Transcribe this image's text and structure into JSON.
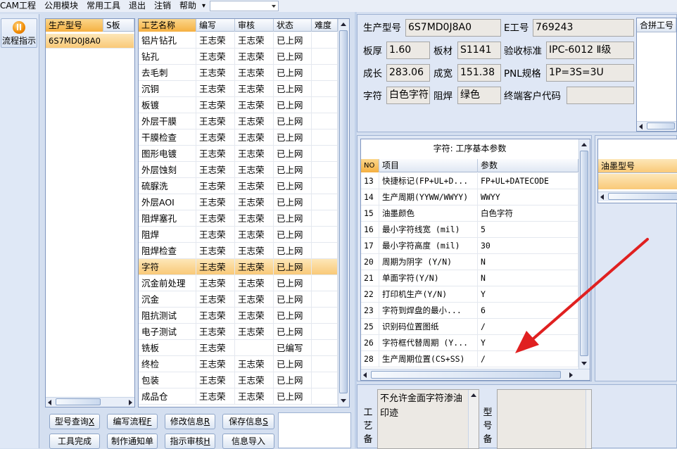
{
  "menu": {
    "items": [
      "CAM工程",
      "公用模块",
      "常用工具",
      "退出",
      "注销",
      "帮助"
    ],
    "help_dropdown": "▾",
    "combo_value": ""
  },
  "left_strip": {
    "flow_button_label": "流程指示",
    "flow_icon": "pause-circle-icon"
  },
  "model_list": {
    "columns": [
      "生产型号",
      "S板"
    ],
    "rows": [
      [
        "6S7MD0J8A0",
        ""
      ]
    ],
    "selected_index": 0
  },
  "process_grid": {
    "columns": [
      "工艺名称",
      "编写",
      "审核",
      "状态",
      "难度"
    ],
    "rows": [
      [
        "铝片钻孔",
        "王志荣",
        "王志荣",
        "已上网",
        ""
      ],
      [
        "钻孔",
        "王志荣",
        "王志荣",
        "已上网",
        ""
      ],
      [
        "去毛刺",
        "王志荣",
        "王志荣",
        "已上网",
        ""
      ],
      [
        "沉铜",
        "王志荣",
        "王志荣",
        "已上网",
        ""
      ],
      [
        "板镀",
        "王志荣",
        "王志荣",
        "已上网",
        ""
      ],
      [
        "外层干膜",
        "王志荣",
        "王志荣",
        "已上网",
        ""
      ],
      [
        "干膜检查",
        "王志荣",
        "王志荣",
        "已上网",
        ""
      ],
      [
        "图形电镀",
        "王志荣",
        "王志荣",
        "已上网",
        ""
      ],
      [
        "外层蚀刻",
        "王志荣",
        "王志荣",
        "已上网",
        ""
      ],
      [
        "硫脲洗",
        "王志荣",
        "王志荣",
        "已上网",
        ""
      ],
      [
        "外层AOI",
        "王志荣",
        "王志荣",
        "已上网",
        ""
      ],
      [
        "阻焊塞孔",
        "王志荣",
        "王志荣",
        "已上网",
        ""
      ],
      [
        "阻焊",
        "王志荣",
        "王志荣",
        "已上网",
        ""
      ],
      [
        "阻焊检查",
        "王志荣",
        "王志荣",
        "已上网",
        ""
      ],
      [
        "字符",
        "王志荣",
        "王志荣",
        "已上网",
        ""
      ],
      [
        "沉金前处理",
        "王志荣",
        "王志荣",
        "已上网",
        ""
      ],
      [
        "沉金",
        "王志荣",
        "王志荣",
        "已上网",
        ""
      ],
      [
        "阻抗测试",
        "王志荣",
        "王志荣",
        "已上网",
        ""
      ],
      [
        "电子测试",
        "王志荣",
        "王志荣",
        "已上网",
        ""
      ],
      [
        "铣板",
        "王志荣",
        "",
        "已编写",
        ""
      ],
      [
        "终检",
        "王志荣",
        "王志荣",
        "已上网",
        ""
      ],
      [
        "包装",
        "王志荣",
        "王志荣",
        "已上网",
        ""
      ],
      [
        "成品仓",
        "王志荣",
        "王志荣",
        "已上网",
        ""
      ]
    ],
    "selected_index": 14
  },
  "buttons": {
    "row1": [
      {
        "label": "型号查询",
        "key": "X"
      },
      {
        "label": "编写流程",
        "key": "F"
      },
      {
        "label": "修改信息",
        "key": "R"
      },
      {
        "label": "保存信息",
        "key": "S"
      }
    ],
    "row2": [
      {
        "label": "工具完成",
        "key": ""
      },
      {
        "label": "制作通知单",
        "key": ""
      },
      {
        "label": "指示审核",
        "key": "H"
      },
      {
        "label": "信息导入",
        "key": ""
      }
    ]
  },
  "info": {
    "model_label": "生产型号",
    "model_value": "6S7MD0J8A0",
    "e_label": "E工号",
    "e_value": "769243",
    "thickness_label": "板厚",
    "thickness_value": "1.60",
    "material_label": "板材",
    "material_value": "S1141",
    "standard_label": "验收标准",
    "standard_value": "IPC-6012 Ⅱ级",
    "length_label": "成长",
    "length_value": "283.06",
    "width_label": "成宽",
    "width_value": "151.38",
    "pnl_label": "PNL规格",
    "pnl_value": "1P=3S=3U",
    "char_label": "字符",
    "char_value": "白色字符",
    "mask_label": "阻焊",
    "mask_value": "绿色",
    "customer_label": "终端客户代码",
    "customer_value": "",
    "merge_label": "合拼工号"
  },
  "param_grid": {
    "title": "字符: 工序基本参数",
    "columns": [
      "NO",
      "项目",
      "参数"
    ],
    "rows": [
      [
        "13",
        "快捷标记(FP+UL+D...",
        "FP+UL+DATECODE"
      ],
      [
        "14",
        "生产周期(YYWW/WWYY)",
        "WWYY"
      ],
      [
        "15",
        "油墨颜色",
        "白色字符"
      ],
      [
        "16",
        "最小字符线宽 (mil)",
        "5"
      ],
      [
        "17",
        "最小字符高度 (mil)",
        "30"
      ],
      [
        "20",
        "周期为阴字 (Y/N)",
        "N"
      ],
      [
        "21",
        "单面字符(Y/N)",
        "N"
      ],
      [
        "22",
        "打印机生产(Y/N)",
        "Y"
      ],
      [
        "23",
        "字符到焊盘的最小...",
        "6"
      ],
      [
        "25",
        "识别码位置图纸",
        "/"
      ],
      [
        "26",
        "字符框代替周期 (Y...",
        "Y"
      ],
      [
        "28",
        "生产周期位置(CS+SS)",
        "/"
      ]
    ]
  },
  "ink_panel": {
    "column": "油墨型号"
  },
  "notes": {
    "process_label": "工艺备",
    "process_text": "不允许金面字符渗油印迹",
    "model_label": "型号备"
  },
  "annotation": {
    "arrow_color": "#e02020"
  }
}
